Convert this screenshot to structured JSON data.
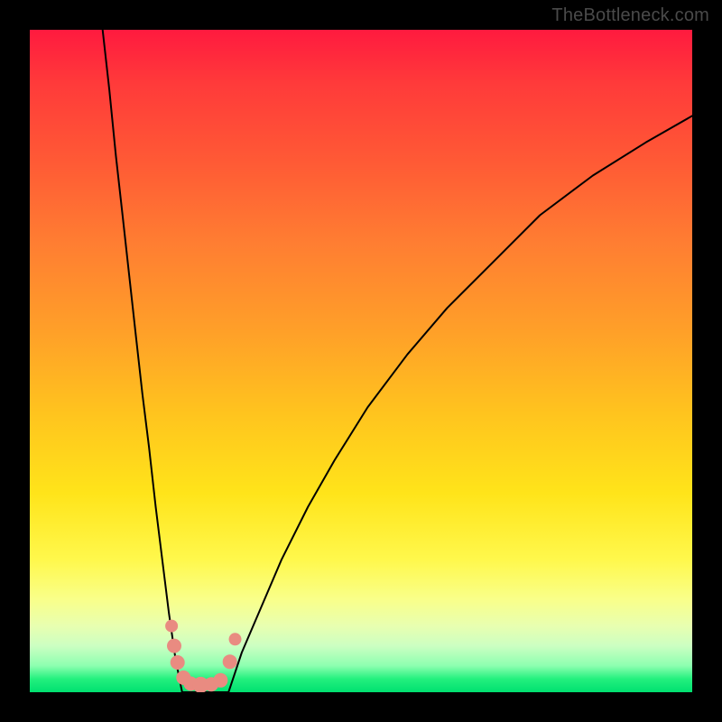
{
  "watermark": "TheBottleneck.com",
  "colors": {
    "frame": "#000000",
    "curve_stroke": "#000000",
    "marker_fill": "#e98b81",
    "gradient_stops": [
      "#ff1a3f",
      "#ff3a3a",
      "#ff5a35",
      "#ff7d32",
      "#ffa128",
      "#ffc41e",
      "#ffe41a",
      "#fff84c",
      "#f9ff8a",
      "#e8ffb0",
      "#ccffc2",
      "#8dffb0",
      "#23f07e",
      "#00e070"
    ]
  },
  "chart_data": {
    "type": "line",
    "title": "",
    "xlabel": "",
    "ylabel": "",
    "xlim": [
      0,
      100
    ],
    "ylim": [
      0,
      100
    ],
    "grid": false,
    "legend": null,
    "note": "No axes, ticks or numeric labels are rendered in the image; values below are estimated from pixel positions within the plot box (0–100 each axis, y increasing upward).",
    "series": [
      {
        "name": "left-branch",
        "x": [
          11,
          12,
          13,
          14,
          15,
          16,
          17,
          18,
          19,
          20,
          21,
          22,
          23
        ],
        "y": [
          100,
          91,
          81,
          72,
          63,
          54,
          45,
          37,
          28,
          20,
          12,
          5,
          0
        ]
      },
      {
        "name": "valley-floor",
        "x": [
          23,
          24,
          25,
          26,
          27,
          28,
          29,
          30
        ],
        "y": [
          0,
          0,
          0,
          0,
          0,
          0,
          0,
          0
        ]
      },
      {
        "name": "right-branch",
        "x": [
          30,
          32,
          35,
          38,
          42,
          46,
          51,
          57,
          63,
          70,
          77,
          85,
          93,
          100
        ],
        "y": [
          0,
          6,
          13,
          20,
          28,
          35,
          43,
          51,
          58,
          65,
          72,
          78,
          83,
          87
        ]
      }
    ],
    "markers": {
      "name": "salmon-dots",
      "x": [
        21.4,
        21.8,
        22.3,
        23.2,
        24.3,
        25.8,
        27.4,
        28.8,
        30.2,
        31.0
      ],
      "y": [
        10.0,
        7.0,
        4.5,
        2.2,
        1.3,
        1.1,
        1.2,
        1.8,
        4.6,
        8.0
      ],
      "r": [
        7,
        8,
        8,
        8,
        8,
        9,
        8,
        8,
        8,
        7
      ]
    }
  }
}
